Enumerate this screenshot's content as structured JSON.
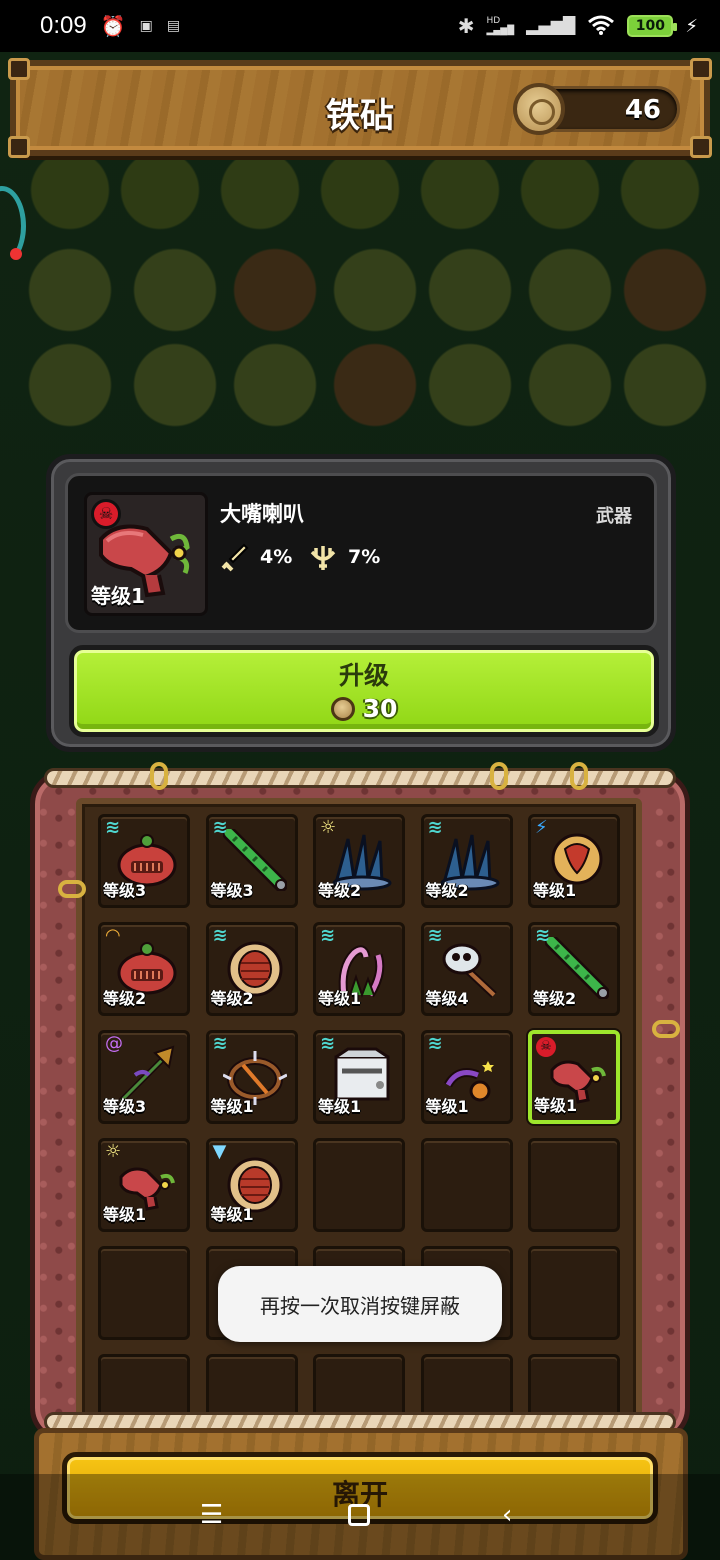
{
  "status_bar": {
    "time": "0:09",
    "battery": "100",
    "network_label": "HD"
  },
  "header": {
    "title": "铁砧",
    "coins": "46"
  },
  "item_detail": {
    "name": "大嘴喇叭",
    "type": "武器",
    "level": "等级1",
    "attack_pct": "4%",
    "defense_pct": "7%"
  },
  "upgrade": {
    "label": "升级",
    "cost": "30"
  },
  "inventory": {
    "slots": [
      {
        "level": "等级3",
        "badge": "wave",
        "item": "red-pot"
      },
      {
        "level": "等级3",
        "badge": "wave",
        "item": "green-staff"
      },
      {
        "level": "等级2",
        "badge": "sun",
        "item": "blue-spikes"
      },
      {
        "level": "等级2",
        "badge": "wave",
        "item": "blue-spikes"
      },
      {
        "level": "等级1",
        "badge": "lightning",
        "item": "red-amulet"
      },
      {
        "level": "等级2",
        "badge": "hand",
        "item": "red-pot"
      },
      {
        "level": "等级2",
        "badge": "wave",
        "item": "turtle-shell"
      },
      {
        "level": "等级1",
        "badge": "wave",
        "item": "pink-tentacles"
      },
      {
        "level": "等级4",
        "badge": "wave",
        "item": "skull-axe"
      },
      {
        "level": "等级2",
        "badge": "wave",
        "item": "green-staff"
      },
      {
        "level": "等级3",
        "badge": "spiral",
        "item": "purple-wand"
      },
      {
        "level": "等级1",
        "badge": "wave",
        "item": "spiked-ring"
      },
      {
        "level": "等级1",
        "badge": "wave",
        "item": "milk-carton"
      },
      {
        "level": "等级1",
        "badge": "wave",
        "item": "purple-slingshot"
      },
      {
        "level": "等级1",
        "badge": "skull",
        "item": "red-horn",
        "selected": true
      },
      {
        "level": "等级1",
        "badge": "sun",
        "item": "red-horn"
      },
      {
        "level": "等级1",
        "badge": "tornado",
        "item": "turtle-shell"
      },
      {
        "level": "",
        "item": "empty"
      },
      {
        "level": "",
        "item": "empty"
      },
      {
        "level": "",
        "item": "empty"
      },
      {
        "level": "",
        "item": "empty"
      },
      {
        "level": "",
        "item": "empty"
      },
      {
        "level": "",
        "item": "empty"
      },
      {
        "level": "",
        "item": "empty"
      },
      {
        "level": "",
        "item": "empty"
      },
      {
        "level": "",
        "item": "empty"
      },
      {
        "level": "",
        "item": "empty"
      },
      {
        "level": "",
        "item": "empty"
      },
      {
        "level": "",
        "item": "empty"
      },
      {
        "level": "",
        "item": "empty"
      }
    ]
  },
  "toast": "再按一次取消按键屏蔽",
  "leave_button": "离开",
  "colors": {
    "accent_green": "#9ee62c",
    "upgrade_green": "#a6e522",
    "leave_yellow": "#f1b60c",
    "wood": "#a3712f",
    "chest_red": "#8f4a49"
  }
}
